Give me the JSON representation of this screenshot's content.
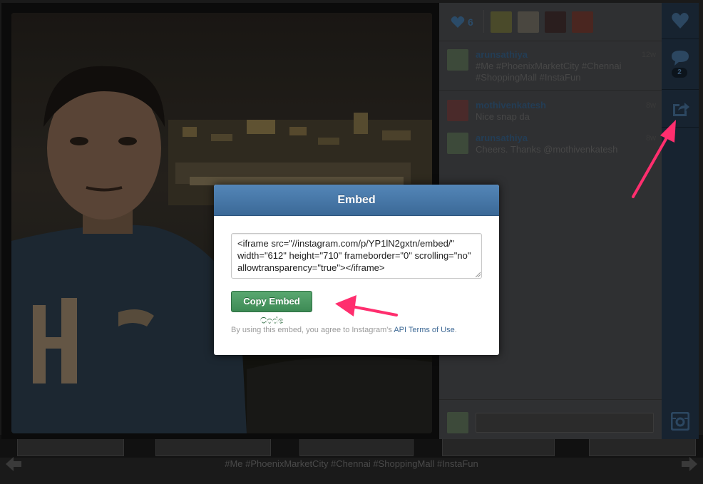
{
  "likes": {
    "count": "6",
    "likers": [
      {
        "avatar": "liker-1"
      },
      {
        "avatar": "liker-2"
      },
      {
        "avatar": "liker-3"
      },
      {
        "avatar": "liker-4"
      }
    ]
  },
  "comments": [
    {
      "user": "arunsathiya",
      "time": "12w",
      "text": "#Me #PhoenixMarketCity #Chennai #ShoppingMall #InstaFun"
    },
    {
      "user": "mothivenkatesh",
      "time": "8w",
      "text": "Nice snap da"
    },
    {
      "user": "arunsathiya",
      "time": "8w",
      "text": "Cheers. Thanks @mothivenkatesh"
    }
  ],
  "rail": {
    "comment_count": "2",
    "icons": [
      "heart-icon",
      "comment-icon",
      "share-icon",
      "instagram-icon"
    ]
  },
  "modal": {
    "title": "Embed",
    "code": "<iframe src=\"//instagram.com/p/YP1lN2gxtn/embed/\" width=\"612\" height=\"710\" frameborder=\"0\" scrolling=\"no\" allowtransparency=\"true\"></iframe>",
    "button_label": "Copy Embed Code",
    "disclaimer_prefix": "By using this embed, you agree to Instagram's",
    "disclaimer_link": "API Terms of Use",
    "disclaimer_suffix": "."
  },
  "strip": {
    "caption": "#Me #PhoenixMarketCity #Chennai #ShoppingMall #InstaFun"
  },
  "colors": {
    "accent": "#3b6997",
    "button": "#3d8a55",
    "callout": "#ff2e6e",
    "rail": "#172330"
  }
}
